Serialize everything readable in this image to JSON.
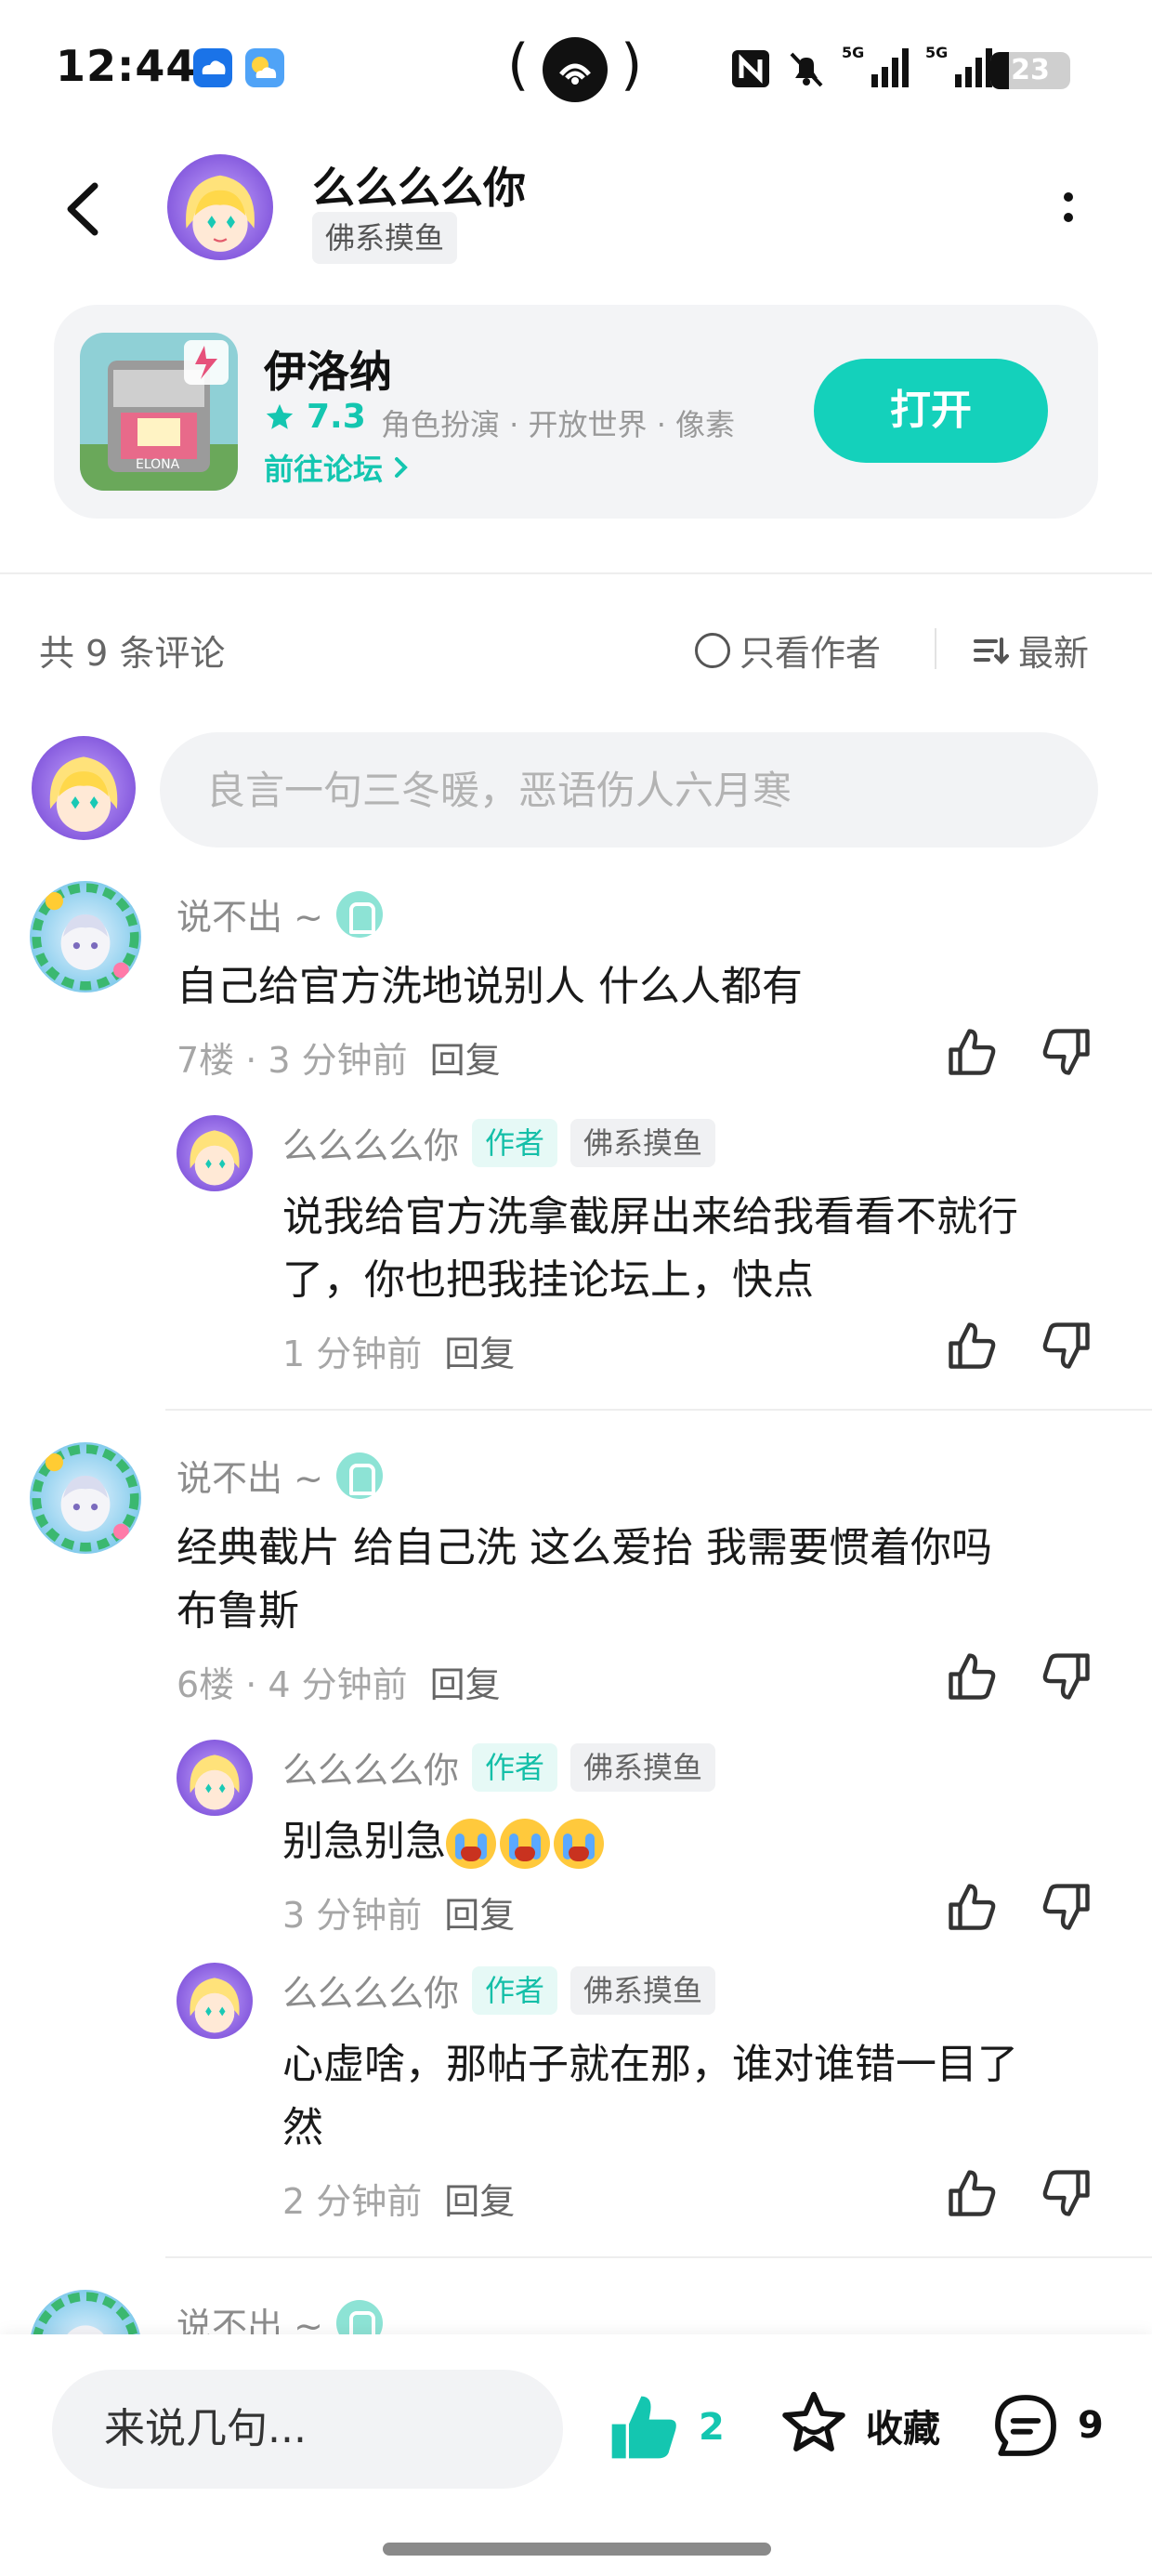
{
  "status_bar": {
    "time": "12:44",
    "battery": "23",
    "battery_level": 0.23,
    "network": [
      "5G",
      "5G"
    ],
    "icons": [
      "cloud-app-icon",
      "weather-icon",
      "hotspot-icon",
      "nfc-icon",
      "mute-icon",
      "signal-icon",
      "battery-icon"
    ]
  },
  "header": {
    "author_name": "么么么么你",
    "author_tag": "佛系摸鱼"
  },
  "game_card": {
    "name": "伊洛纳",
    "rating": "7.3",
    "tags": "角色扮演 · 开放世界 · 像素",
    "forum_link": "前往论坛",
    "open_button": "打开"
  },
  "comments_toolbar": {
    "count_label": "共 9 条评论",
    "author_only_label": "只看作者",
    "sort_label": "最新"
  },
  "comment_input": {
    "placeholder": "良言一句三冬暖，恶语伤人六月寒"
  },
  "comments": [
    {
      "user": "说不出 ~",
      "text": "自己给官方洗地说别人 什么人都有",
      "meta": "7楼 · 3 分钟前",
      "reply_label": "回复",
      "replies": [
        {
          "user": "么么么么你",
          "badge_author": "作者",
          "badge_tag": "佛系摸鱼",
          "text_line1": "说我给官方洗拿截屏出来给我看看不就行",
          "text_line2": "了，你也把我挂论坛上，快点",
          "meta": "1 分钟前",
          "reply_label": "回复"
        }
      ]
    },
    {
      "user": "说不出 ~",
      "text_line1": "经典截片 给自己洗 这么爱抬 我需要惯着你吗",
      "text_line2": "布鲁斯",
      "meta": "6楼 · 4 分钟前",
      "reply_label": "回复",
      "replies": [
        {
          "user": "么么么么你",
          "badge_author": "作者",
          "badge_tag": "佛系摸鱼",
          "text_line1": "别急别急",
          "emoji": "loudly-crying-face x3",
          "meta": "3 分钟前",
          "reply_label": "回复"
        },
        {
          "user": "么么么么你",
          "badge_author": "作者",
          "badge_tag": "佛系摸鱼",
          "text_line1": "心虚啥，那帖子就在那，谁对谁错一目了",
          "text_line2": "然",
          "meta": "2 分钟前",
          "reply_label": "回复"
        }
      ]
    },
    {
      "user": "说不出 ~"
    }
  ],
  "bottom_bar": {
    "input_label": "来说几句...",
    "like_count": "2",
    "favorite_label": "收藏",
    "comment_count": "9"
  },
  "colors": {
    "accent": "#14c6b0",
    "open_button": "#14d1bb",
    "card_bg": "#f3f4f6",
    "muted_text": "#8c8c8c"
  }
}
